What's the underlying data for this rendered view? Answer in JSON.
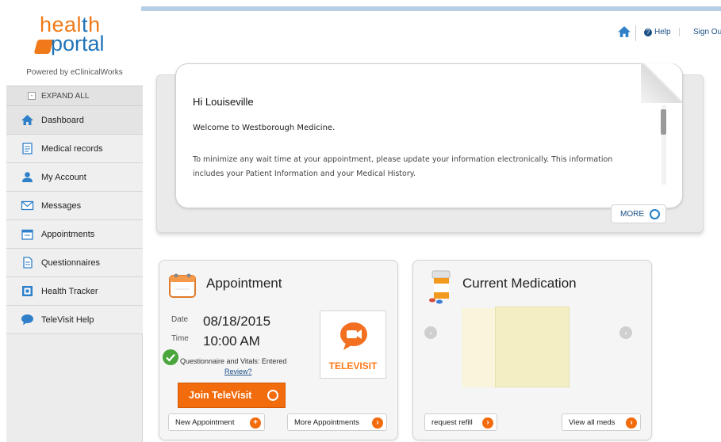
{
  "brand": {
    "word1": "heal",
    "word1_t": "t",
    "word1_end": "h",
    "word2": "portal",
    "powered_by": "Powered by eClinicalWorks"
  },
  "sidebar": {
    "expand_label": "EXPAND ALL",
    "expand_symbol": "-",
    "items": [
      {
        "label": "Dashboard",
        "icon": "home-icon"
      },
      {
        "label": "Medical records",
        "icon": "clipboard-icon"
      },
      {
        "label": "My Account",
        "icon": "user-icon"
      },
      {
        "label": "Messages",
        "icon": "envelope-icon"
      },
      {
        "label": "Appointments",
        "icon": "calendar-icon"
      },
      {
        "label": "Questionnaires",
        "icon": "document-icon"
      },
      {
        "label": "Health Tracker",
        "icon": "tracker-icon"
      },
      {
        "label": "TeleVisit Help",
        "icon": "chat-bubble-icon"
      }
    ]
  },
  "toolbar": {
    "help_label": "Help",
    "help_symbol": "?",
    "signout_label": "Sign Out"
  },
  "welcome": {
    "greeting": "Hi Louiseville",
    "headline": "Welcome to Westborough Medicine.",
    "body": "To minimize any wait time at your appointment, please update your information electronically. This information includes your Patient Information and your Medical History.",
    "more_label": "MORE"
  },
  "appointment": {
    "title": "Appointment",
    "date_key": "Date",
    "date_value": "08/18/2015",
    "time_key": "Time",
    "time_value": "10:00 AM",
    "status": "Questionnaire and Vitals: Entered",
    "review_link": "Review?",
    "televisit_label": "TELEVISIT",
    "join_label": "Join TeleVisit",
    "new_label": "New Appointment",
    "more_label": "More Appointments"
  },
  "medication": {
    "title": "Current Medication",
    "refill_label": "request refill",
    "view_all_label": "View all meds"
  },
  "colors": {
    "brand_orange": "#f07a1a",
    "brand_blue": "#1f73b7",
    "join_button": "#f26b0c",
    "status_green": "#4aa63c"
  }
}
